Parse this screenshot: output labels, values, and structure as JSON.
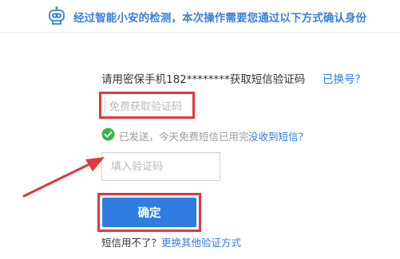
{
  "header": {
    "icon": "robot-icon",
    "message": "经过智能小安的检测，本次操作需要您通过以下方式确认身份"
  },
  "verify": {
    "prompt": "请用密保手机182********获取短信验证码",
    "change_number_link": "已换号？",
    "free_code_button": "免费获取验证码",
    "sent_icon": "check-circle-icon",
    "sent_status": "已发送，今天免费短信已用完",
    "not_received_link": "没收到短信？",
    "code_input_placeholder": "填入验证码",
    "confirm_button": "确定",
    "sms_question": "短信用不了？",
    "other_methods_link": "更换其他验证方式"
  },
  "colors": {
    "accent_blue": "#2f7de1",
    "highlight_red": "#e0383e",
    "success_green": "#3cb44b"
  }
}
